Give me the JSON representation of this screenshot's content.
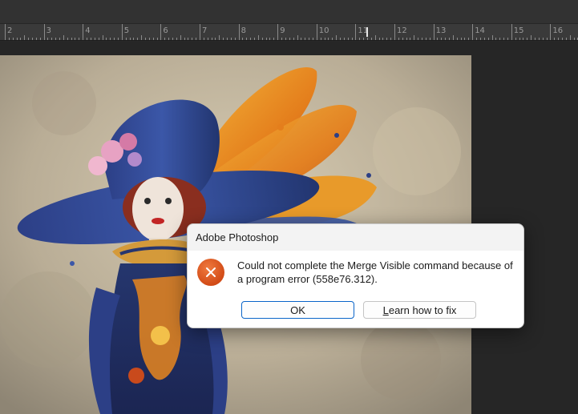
{
  "ruler": {
    "labels": [
      "2",
      "3",
      "4",
      "5",
      "6",
      "7",
      "8",
      "9",
      "10",
      "11",
      "12",
      "13",
      "14",
      "15",
      "16"
    ]
  },
  "dialog": {
    "title": "Adobe Photoshop",
    "message": "Could not complete the Merge Visible command because of a program error (558e76.312).",
    "icon": "error-x-icon",
    "ok_label": "OK",
    "learn_prefix": "L",
    "learn_rest": "earn how to fix",
    "accent_color": "#0a64c8",
    "error_color": "#d24b17"
  }
}
